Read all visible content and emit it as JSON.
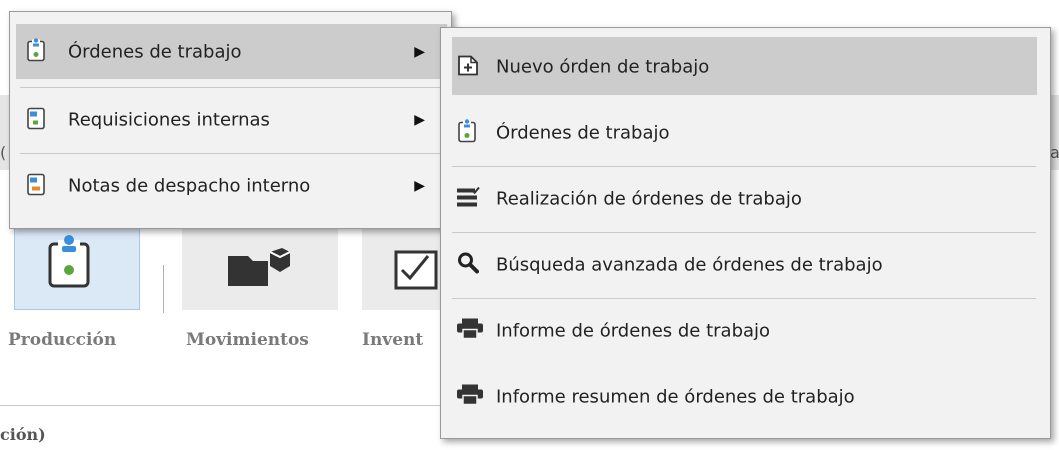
{
  "menu_primary": {
    "items": [
      {
        "label": "Órdenes de trabajo",
        "icon": "work-order-doc-icon",
        "has_submenu": true,
        "highlighted": true
      },
      {
        "label": "Requisiciones internas",
        "icon": "requisition-doc-icon",
        "has_submenu": true
      },
      {
        "label": "Notas de despacho interno",
        "icon": "dispatch-note-doc-icon",
        "has_submenu": true
      }
    ],
    "submenu_arrow": "▶"
  },
  "menu_secondary": {
    "items": [
      {
        "label": "Nuevo órden de trabajo",
        "icon": "new-document-icon",
        "highlighted": true
      },
      {
        "label": "Órdenes de trabajo",
        "icon": "work-order-doc-icon"
      },
      {
        "label": "Realización de órdenes de trabajo",
        "icon": "edit-list-icon"
      },
      {
        "label": "Búsqueda avanzada de órdenes de trabajo",
        "icon": "search-icon"
      },
      {
        "label": "Informe de órdenes de trabajo",
        "icon": "printer-icon"
      },
      {
        "label": "Informe resumen de órdenes de trabajo",
        "icon": "printer-icon"
      }
    ]
  },
  "ribbon": {
    "buttons": [
      {
        "label": "Producción",
        "icon": "production-icon",
        "selected": true
      },
      {
        "label": "Movimientos",
        "icon": "folder-box-icon"
      },
      {
        "label": "Invent",
        "icon": "inventory-check-icon"
      }
    ]
  },
  "status_bar": {
    "text": "ción)"
  },
  "background": {
    "left_glyph": "(",
    "right_glyph": "a"
  },
  "colors": {
    "highlight": "#cccccc",
    "menu_bg": "#f2f2f2",
    "ribbon_selected": "#dbe8f6"
  }
}
